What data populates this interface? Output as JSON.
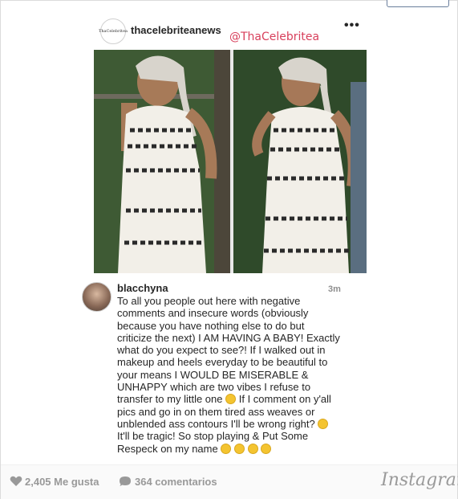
{
  "post": {
    "username": "thacelebriteanews",
    "avatar_text": "ThaCelebritea",
    "watermark": "@ThaCelebritea",
    "more_icon": "ellipsis-icon"
  },
  "comment": {
    "username": "blacchyna",
    "time": "3m",
    "lines": [
      "To all you people out here with negative",
      "comments and insecure words (obviously",
      "because you have nothing else to do but",
      "criticize the next) I AM HAVING A BABY! Exactly",
      "what do you expect to see?! If I walked out in",
      "makeup and heels everyday to be beautiful to",
      "your means I WOULD BE MISERABLE &",
      "UNHAPPY which are two vibes I refuse to",
      "transfer to my little one",
      "If I comment on y'all",
      "pics and go in on them tired ass weaves or",
      "unblended ass contours I'll be wrong right?",
      "It'll be tragic! So stop playing & Put Some",
      "Respeck on my name"
    ]
  },
  "footer": {
    "likes": "2,405 Me gusta",
    "comments": "364 comentarios",
    "logo": "Instagram"
  },
  "colors": {
    "watermark": "#d8405c",
    "muted": "#999999",
    "text": "#262626"
  }
}
